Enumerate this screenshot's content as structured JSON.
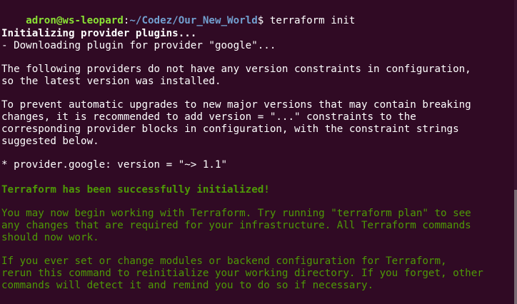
{
  "colors": {
    "background": "#300a24",
    "text": "#ffffff",
    "prompt_user": "#8ae234",
    "prompt_path": "#729fcf",
    "success_green": "#4e9a06"
  },
  "prompt": {
    "user_host": "adron@ws-leopard",
    "separator": ":",
    "path": "~/Codez/Our_New_World",
    "symbol": "$",
    "command": " terraform init"
  },
  "output": {
    "init_heading": "Initializing provider plugins...",
    "downloading": "- Downloading plugin for provider \"google\"...",
    "constraints_1": "The following providers do not have any version constraints in configuration,",
    "constraints_2": "so the latest version was installed.",
    "prevent_1": "To prevent automatic upgrades to new major versions that may contain breaking",
    "prevent_2": "changes, it is recommended to add version = \"...\" constraints to the",
    "prevent_3": "corresponding provider blocks in configuration, with the constraint strings",
    "prevent_4": "suggested below.",
    "provider_version": "* provider.google: version = \"~> 1.1\"",
    "success": "Terraform has been successfully initialized!",
    "begin_1": "You may now begin working with Terraform. Try running \"terraform plan\" to see",
    "begin_2": "any changes that are required for your infrastructure. All Terraform commands",
    "begin_3": "should now work.",
    "reinit_1": "If you ever set or change modules or backend configuration for Terraform,",
    "reinit_2": "rerun this command to reinitialize your working directory. If you forget, other",
    "reinit_3": "commands will detect it and remind you to do so if necessary."
  }
}
